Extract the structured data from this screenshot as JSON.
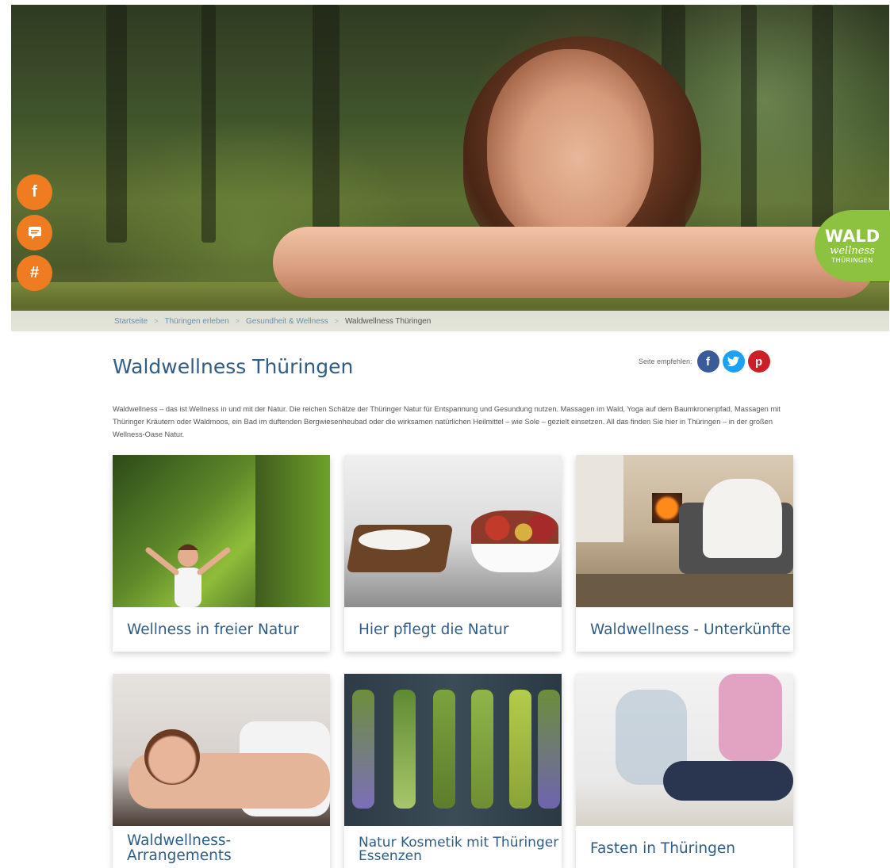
{
  "breadcrumb": {
    "items": [
      "Startseite",
      "Thüringen erleben",
      "Gesundheit & Wellness"
    ],
    "separator": ">",
    "current": "Waldwellness Thüringen"
  },
  "social_sidebar": {
    "facebook": "f",
    "feedback": "feedback-icon",
    "hashtag": "#"
  },
  "badge": {
    "line1": "WALD",
    "line2": "wellness",
    "line3": "THÜRINGEN",
    "color": "#8cc23f"
  },
  "page": {
    "title": "Waldwellness Thüringen",
    "share_label": "Seite empfehlen:",
    "intro": "Waldwellness – das ist Wellness in und mit der Natur. Die reichen Schätze der Thüringer Natur für Entspannung und Gesundung nutzen. Massagen im Wald, Yoga auf dem Baumkronenpfad, Massagen mit Thüringer Kräutern oder Waldmoos, ein Bad im duftenden Bergwiesenheubad oder die wirksamen natürlichen Heilmittel – wie Sole – gezielt einsetzen. All das finden Sie hier in Thüringen – in der großen Wellness-Oase Natur."
  },
  "share_icons": {
    "facebook": "f",
    "twitter": "t",
    "pinterest": "p"
  },
  "cards": [
    {
      "title": "Wellness in freier Natur"
    },
    {
      "title": "Hier pflegt die Natur"
    },
    {
      "title": "Waldwellness - Unterkünfte"
    },
    {
      "title": "Waldwellness-Arrangements"
    },
    {
      "title": "Natur Kosmetik mit Thüringer Essenzen"
    },
    {
      "title": "Fasten in Thüringen"
    }
  ],
  "colors": {
    "accent_orange": "#f07c21",
    "title_blue": "#2f5d86",
    "facebook": "#3b5a9a",
    "twitter": "#1da1f2",
    "pinterest": "#cb2027"
  }
}
